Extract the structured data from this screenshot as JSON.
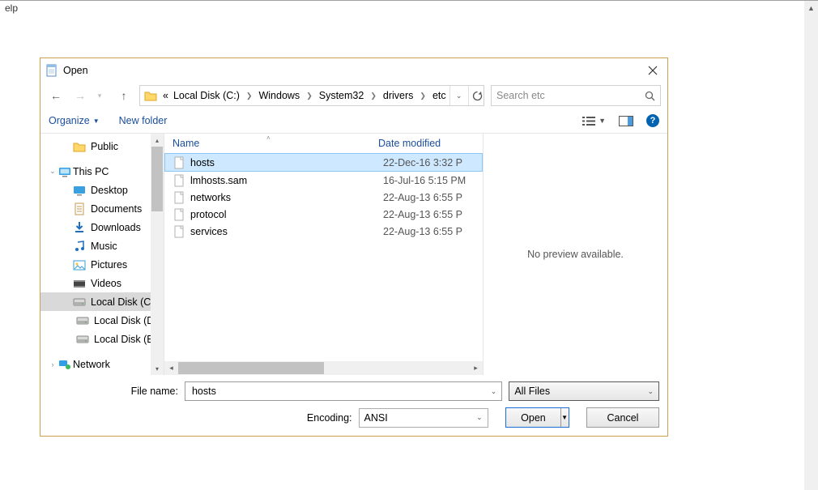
{
  "menu_fragment": "elp",
  "dialog": {
    "title": "Open",
    "breadcrumbs_prefix": "«",
    "breadcrumbs": [
      "Local Disk (C:)",
      "Windows",
      "System32",
      "drivers",
      "etc"
    ],
    "search_placeholder": "Search etc",
    "organize_label": "Organize",
    "newfolder_label": "New folder",
    "preview_text": "No preview available.",
    "filename_label": "File name:",
    "filename_value": "hosts",
    "filter_value": "All Files",
    "encoding_label": "Encoding:",
    "encoding_value": "ANSI",
    "open_label": "Open",
    "cancel_label": "Cancel"
  },
  "columns": {
    "name": "Name",
    "date": "Date modified"
  },
  "tree": {
    "items": [
      {
        "label": "Public",
        "icon": "folder",
        "indent": "sub"
      },
      {
        "label": "",
        "icon": "none",
        "indent": "spacer"
      },
      {
        "label": "This PC",
        "icon": "pc",
        "indent": "root",
        "expand": "down"
      },
      {
        "label": "Desktop",
        "icon": "desktop",
        "indent": "sub"
      },
      {
        "label": "Documents",
        "icon": "doc",
        "indent": "sub"
      },
      {
        "label": "Downloads",
        "icon": "download",
        "indent": "sub"
      },
      {
        "label": "Music",
        "icon": "music",
        "indent": "sub"
      },
      {
        "label": "Pictures",
        "icon": "picture",
        "indent": "sub"
      },
      {
        "label": "Videos",
        "icon": "video",
        "indent": "sub"
      },
      {
        "label": "Local Disk (C:)",
        "icon": "disk",
        "indent": "sub",
        "selected": true
      },
      {
        "label": "Local Disk (D:)",
        "icon": "disk",
        "indent": "sub2"
      },
      {
        "label": "Local Disk (E:)",
        "icon": "disk",
        "indent": "sub2"
      },
      {
        "label": "",
        "icon": "none",
        "indent": "spacer"
      },
      {
        "label": "Network",
        "icon": "network",
        "indent": "root",
        "expand": "right"
      }
    ]
  },
  "files": [
    {
      "name": "hosts",
      "date": "22-Dec-16 3:32 P",
      "selected": true
    },
    {
      "name": "lmhosts.sam",
      "date": "16-Jul-16 5:15 PM"
    },
    {
      "name": "networks",
      "date": "22-Aug-13 6:55 P"
    },
    {
      "name": "protocol",
      "date": "22-Aug-13 6:55 P"
    },
    {
      "name": "services",
      "date": "22-Aug-13 6:55 P"
    }
  ]
}
